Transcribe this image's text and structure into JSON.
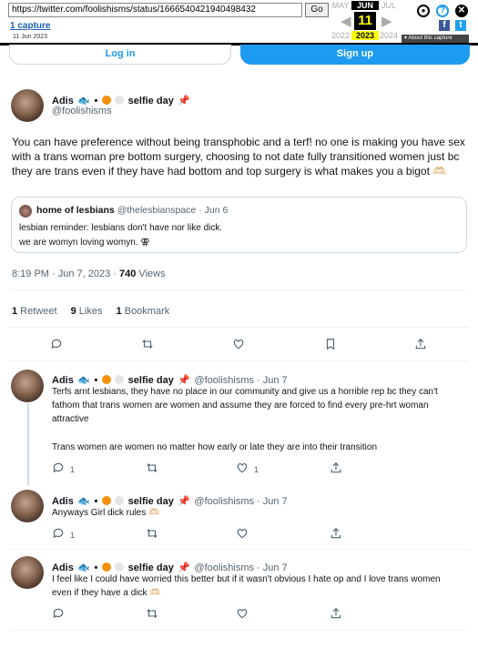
{
  "wayback": {
    "url": "https://twitter.com/foolishisms/status/1666540421940498432",
    "go_label": "Go",
    "captures_link": "1 capture",
    "capture_date": "11 Jun 2023",
    "month_prev": "MAY",
    "month_cur": "JUN",
    "month_next": "JUL",
    "day": "11",
    "year_prev": "2022",
    "year_cur": "2023",
    "year_next": "2024",
    "about_label": "▾ About this capture"
  },
  "auth": {
    "login_label": "Log in",
    "signup_label": "Sign up"
  },
  "main_tweet": {
    "display_name": "Adis",
    "name_suffix": "selfie day",
    "handle": "@foolishisms",
    "text": "You can have preference without being transphobic and a terf! no one is making you have sex with a trans woman pre bottom surgery, choosing to not date fully transitioned women just bc they are trans even if they have had bottom and top surgery is what makes you a bigot 🫶🏻",
    "quote": {
      "name": "home of lesbians",
      "handle": "@thelesbianspace",
      "date": "· Jun 6",
      "line1": "lesbian reminder: lesbians don't have nor like dick.",
      "line2": "we are womyn loving womyn. ⚢"
    },
    "time": "8:19 PM · Jun 7, 2023 · ",
    "views_count": "740",
    "views_label": " Views",
    "retweets_count": "1",
    "retweets_label": " Retweet",
    "likes_count": "9",
    "likes_label": " Likes",
    "bookmarks_count": "1",
    "bookmarks_label": " Bookmark"
  },
  "replies": [
    {
      "display_name": "Adis",
      "name_suffix": "selfie day",
      "handle": "@foolishisms · Jun 7",
      "text1": "Terfs arnt lesbians, they have no place in our community and give us a horrible rep bc they can't fathom that trans women are women and assume they are forced to find every pre-hrt woman attractive",
      "text2": "Trans women are women no matter how early or late they are into their transition",
      "reply_count": "1",
      "like_count": "1"
    },
    {
      "display_name": "Adis",
      "name_suffix": "selfie day",
      "handle": "@foolishisms · Jun 7",
      "text1": "Anyways Girl dick rules 🫶🏻",
      "reply_count": "1"
    },
    {
      "display_name": "Adis",
      "name_suffix": "selfie day",
      "handle": "@foolishisms · Jun 7",
      "text1": "I feel like I could have worried this better but if it wasn't obvious I hate op and I love trans women even if they have a dick 🫶🏻"
    }
  ],
  "colors": {
    "accent": "#1d9bf0",
    "text": "#0f1419",
    "muted": "#536471"
  }
}
